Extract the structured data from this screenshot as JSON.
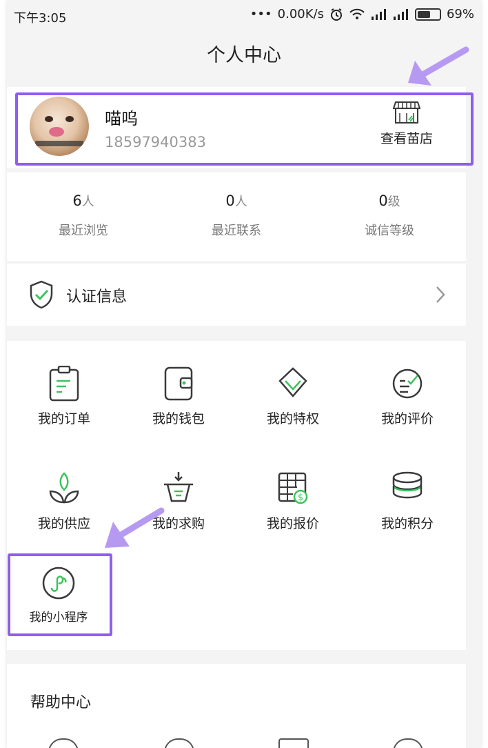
{
  "status_bar": {
    "time": "下午3:05",
    "dots": "•••",
    "speed": "0.00K/s",
    "battery": "69%",
    "battery_level": 0.69,
    "icons": [
      "alarm-icon",
      "wifi-icon",
      "signal-icon",
      "signal-icon",
      "battery-icon"
    ]
  },
  "header": {
    "title": "个人中心"
  },
  "profile": {
    "name": "喵呜",
    "phone": "18597940383",
    "shop_label": "查看苗店",
    "shop_icon": "storefront-icon"
  },
  "stats": [
    {
      "value": "6",
      "unit": "人",
      "label": "最近浏览"
    },
    {
      "value": "0",
      "unit": "人",
      "label": "最近联系"
    },
    {
      "value": "0",
      "unit": "级",
      "label": "诚信等级"
    }
  ],
  "certification": {
    "label": "认证信息",
    "icon": "shield-check-icon",
    "chevron": "chevron-right-icon"
  },
  "menu": [
    {
      "label": "我的订单",
      "icon": "clipboard-icon"
    },
    {
      "label": "我的钱包",
      "icon": "wallet-icon"
    },
    {
      "label": "我的特权",
      "icon": "diamond-icon"
    },
    {
      "label": "我的评价",
      "icon": "checklist-icon"
    },
    {
      "label": "我的供应",
      "icon": "sprout-icon"
    },
    {
      "label": "我的求购",
      "icon": "basket-icon"
    },
    {
      "label": "我的报价",
      "icon": "price-table-icon"
    },
    {
      "label": "我的积分",
      "icon": "coin-stack-icon"
    },
    {
      "label": "我的小程序",
      "icon": "mini-program-icon"
    }
  ],
  "help": {
    "title": "帮助中心"
  },
  "colors": {
    "accent_green": "#3cc35c",
    "icon_dark": "#3a3a3a",
    "annotation_purple": "#8f5ef0",
    "annotation_arrow": "#b69af2",
    "background": "#f4f4f4"
  }
}
